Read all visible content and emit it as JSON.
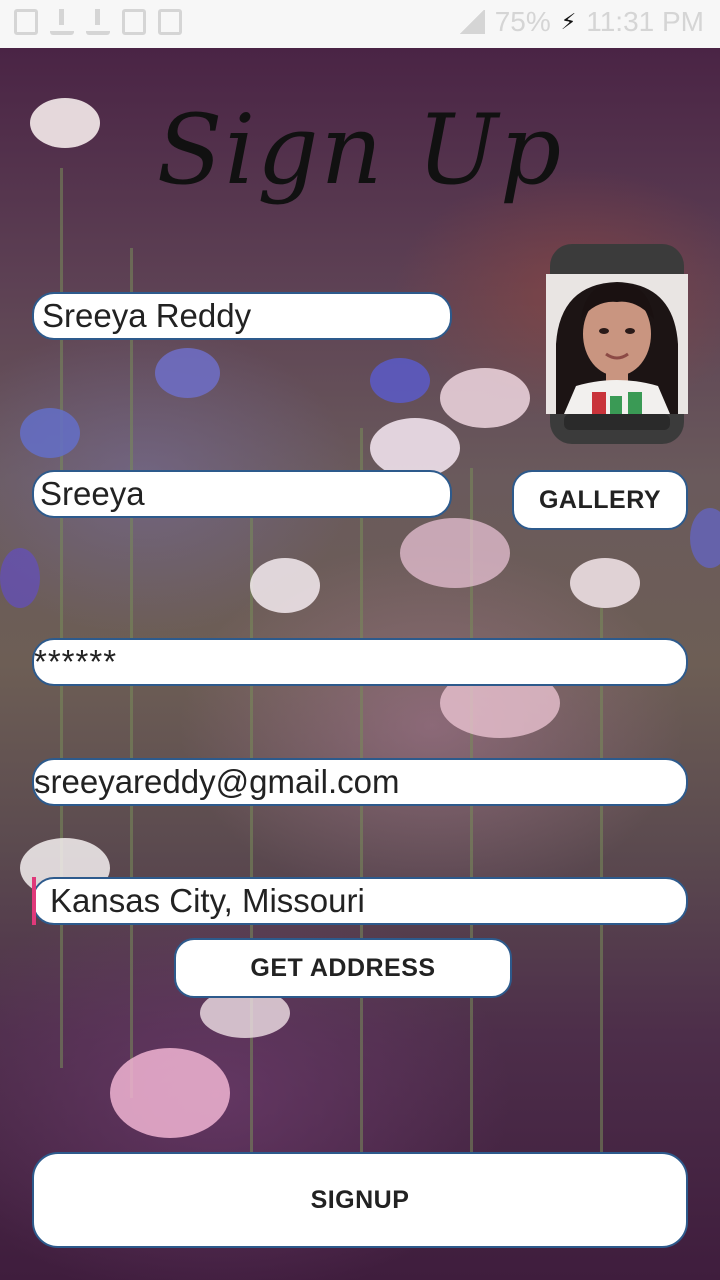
{
  "status_bar": {
    "battery": "75%",
    "time": "11:31 PM",
    "icons": [
      "gallery-icon",
      "download-icon",
      "download-icon",
      "image-icon",
      "file-off-icon",
      "wifi-icon",
      "signal-icon",
      "charging-icon"
    ]
  },
  "form": {
    "title": "Sign Up",
    "name_value": "Sreeya Reddy",
    "username_value": "Sreeya",
    "password_value": "******",
    "email_value": "sreeyareddy@gmail.com",
    "address_value": "Kansas City, Missouri"
  },
  "buttons": {
    "gallery": "GALLERY",
    "get_address": "GET ADDRESS",
    "signup": "SIGNUP"
  },
  "colors": {
    "field_border": "#2d5a8c",
    "caret": "#e0397a",
    "status_bar_bg": "#f7f7f7"
  }
}
